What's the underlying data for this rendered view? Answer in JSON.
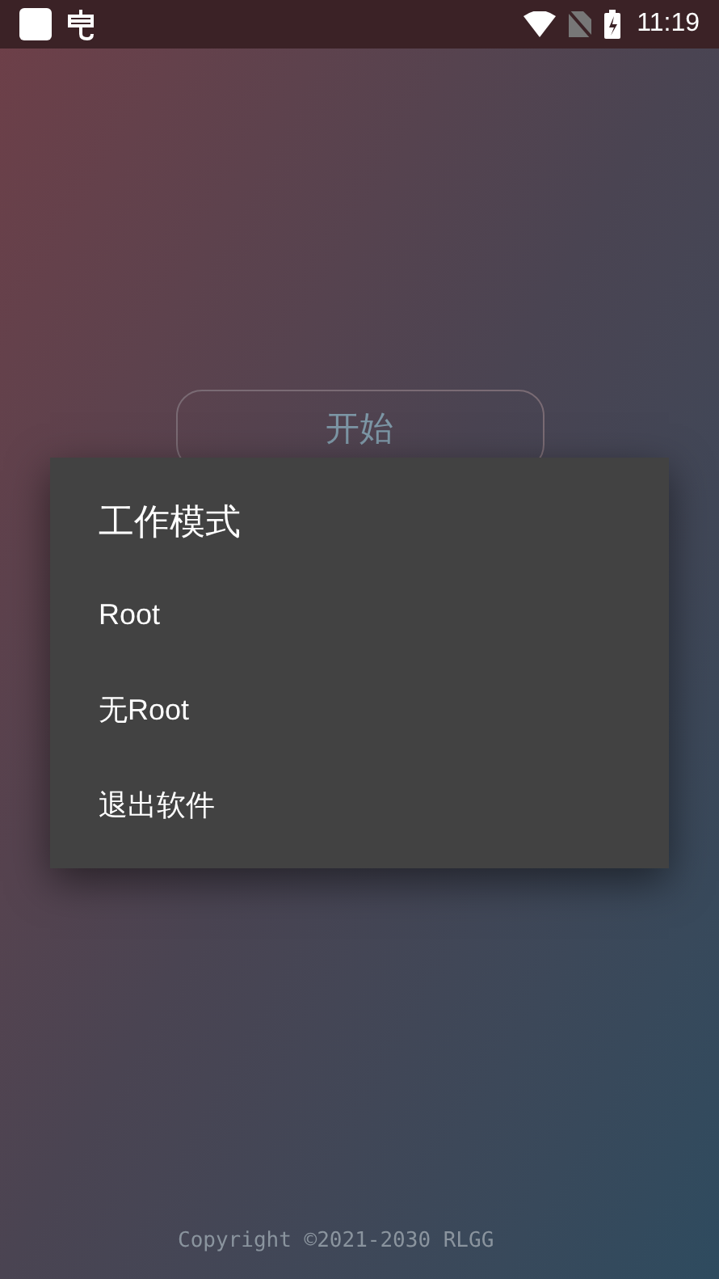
{
  "status_bar": {
    "time": "11:19"
  },
  "start_button": {
    "label": "开始"
  },
  "dialog": {
    "title": "工作模式",
    "items": [
      {
        "label": "Root"
      },
      {
        "label": "无Root"
      },
      {
        "label": "退出软件"
      }
    ]
  },
  "footer": {
    "copyright": "Copyright ©2021-2030 RLGG"
  }
}
